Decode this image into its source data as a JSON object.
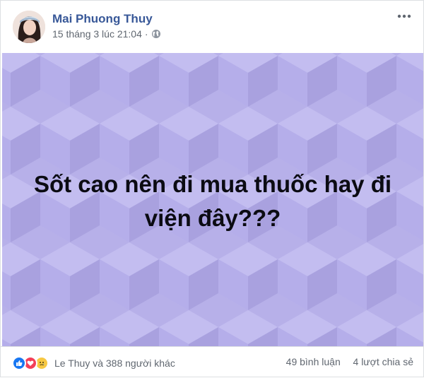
{
  "post": {
    "author": "Mai Phuong Thuy",
    "timestamp": "15 tháng 3 lúc 21:04",
    "separator": "·",
    "privacy_icon": "globe-icon",
    "more_icon": "more-options-icon",
    "status_text": "Sốt cao nên đi mua thuốc hay đi viện đây???",
    "background_colors": [
      "#b7b0e9",
      "#c3bdf0",
      "#a9a1df"
    ]
  },
  "footer": {
    "reaction_icons": [
      "like-icon",
      "love-icon",
      "sad-icon"
    ],
    "reaction_names": "Le Thuy và 388 người khác",
    "comments": "49 bình luận",
    "shares": "4 lượt chia sẻ"
  },
  "colors": {
    "author": "#385898",
    "meta": "#606770",
    "like": "#1877f2",
    "love": "#f33e58",
    "sad": "#f7c843"
  }
}
